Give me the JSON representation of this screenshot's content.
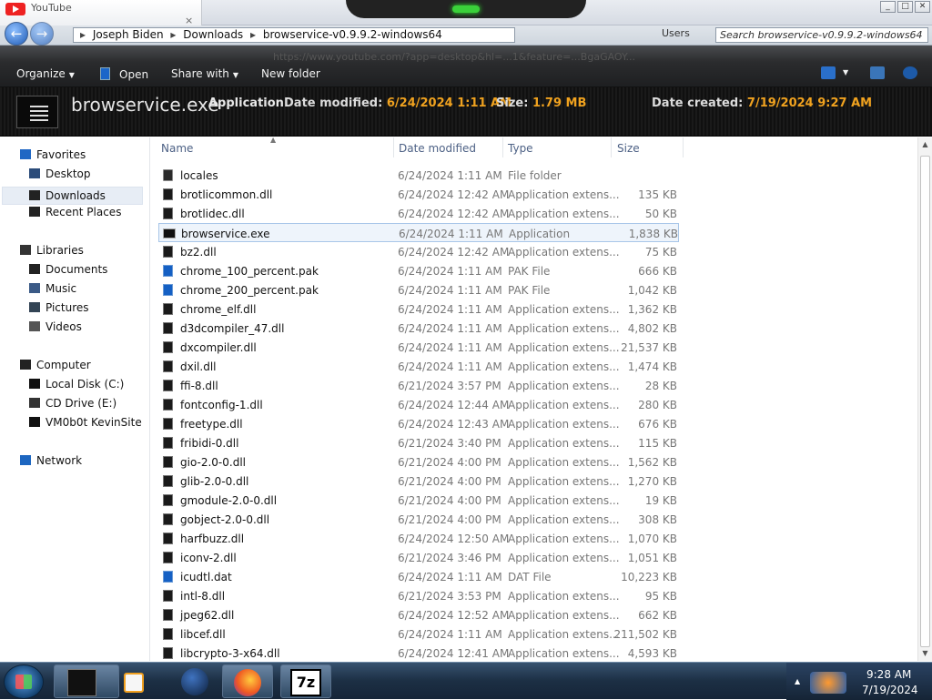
{
  "window": {
    "tab_label": "YouTube",
    "tab_close": "×",
    "controls": [
      "_",
      "□",
      "✕"
    ]
  },
  "nav": {
    "back": "←",
    "forward": "→",
    "breadcrumb": [
      "Joseph Biden",
      "Downloads",
      "browservice-v0.9.9.2-windows64"
    ],
    "breadcrumb_more": "▸",
    "refresh_label": "Users",
    "search_placeholder": "Search browservice-v0.9.9.2-windows64"
  },
  "toolbar": {
    "organize": "Organize",
    "open": "Open",
    "share_with": "Share with",
    "new_folder": "New folder",
    "url_ghost": "https://www.youtube.com/?app=desktop&hl=...1&feature=...BgaGAOY..."
  },
  "details": {
    "name": "browservice.exe",
    "type": "Application",
    "date_modified_label": "Date modified:",
    "date_modified": "6/24/2024 1:11 AM",
    "size_label": "Size:",
    "size": "1.79 MB",
    "date_created_label": "Date created:",
    "date_created": "7/19/2024 9:27 AM",
    "accent_color": "#f0a21f"
  },
  "navpane": {
    "items": [
      {
        "label": "Favorites",
        "icon": "star-icon"
      },
      {
        "label": "Desktop",
        "icon": "desktop-icon"
      },
      {
        "label": "Downloads",
        "icon": "downloads-icon",
        "selected": true
      },
      {
        "label": "Recent Places",
        "icon": "recent-places-icon"
      },
      {
        "label": "Libraries",
        "icon": "libraries-icon"
      },
      {
        "label": "Documents",
        "icon": "documents-icon"
      },
      {
        "label": "Music",
        "icon": "music-icon"
      },
      {
        "label": "Pictures",
        "icon": "pictures-icon"
      },
      {
        "label": "Videos",
        "icon": "videos-icon"
      },
      {
        "label": "Computer",
        "icon": "computer-icon"
      },
      {
        "label": "Local Disk (C:)",
        "icon": "disk-icon"
      },
      {
        "label": "CD Drive (E:)",
        "icon": "cd-drive-icon"
      },
      {
        "label": "VM0b0t KevinSite",
        "icon": "network-drive-icon"
      },
      {
        "label": "Network",
        "icon": "network-icon"
      }
    ]
  },
  "columns": {
    "name": "Name",
    "date_modified": "Date modified",
    "type": "Type",
    "size": "Size"
  },
  "files": [
    {
      "name": "locales",
      "date": "6/24/2024 1:11 AM",
      "type": "File folder",
      "size": "",
      "kind": "folder"
    },
    {
      "name": "brotlicommon.dll",
      "date": "6/24/2024 12:42 AM",
      "type": "Application extens...",
      "size": "135 KB",
      "kind": "dll"
    },
    {
      "name": "brotlidec.dll",
      "date": "6/24/2024 12:42 AM",
      "type": "Application extens...",
      "size": "50 KB",
      "kind": "dll"
    },
    {
      "name": "browservice.exe",
      "date": "6/24/2024 1:11 AM",
      "type": "Application",
      "size": "1,838 KB",
      "kind": "exe",
      "selected": true
    },
    {
      "name": "bz2.dll",
      "date": "6/24/2024 12:42 AM",
      "type": "Application extens...",
      "size": "75 KB",
      "kind": "dll"
    },
    {
      "name": "chrome_100_percent.pak",
      "date": "6/24/2024 1:11 AM",
      "type": "PAK File",
      "size": "666 KB",
      "kind": "pak"
    },
    {
      "name": "chrome_200_percent.pak",
      "date": "6/24/2024 1:11 AM",
      "type": "PAK File",
      "size": "1,042 KB",
      "kind": "pak"
    },
    {
      "name": "chrome_elf.dll",
      "date": "6/24/2024 1:11 AM",
      "type": "Application extens...",
      "size": "1,362 KB",
      "kind": "dll"
    },
    {
      "name": "d3dcompiler_47.dll",
      "date": "6/24/2024 1:11 AM",
      "type": "Application extens...",
      "size": "4,802 KB",
      "kind": "dll"
    },
    {
      "name": "dxcompiler.dll",
      "date": "6/24/2024 1:11 AM",
      "type": "Application extens...",
      "size": "21,537 KB",
      "kind": "dll"
    },
    {
      "name": "dxil.dll",
      "date": "6/24/2024 1:11 AM",
      "type": "Application extens...",
      "size": "1,474 KB",
      "kind": "dll"
    },
    {
      "name": "ffi-8.dll",
      "date": "6/21/2024 3:57 PM",
      "type": "Application extens...",
      "size": "28 KB",
      "kind": "dll"
    },
    {
      "name": "fontconfig-1.dll",
      "date": "6/24/2024 12:44 AM",
      "type": "Application extens...",
      "size": "280 KB",
      "kind": "dll"
    },
    {
      "name": "freetype.dll",
      "date": "6/24/2024 12:43 AM",
      "type": "Application extens...",
      "size": "676 KB",
      "kind": "dll"
    },
    {
      "name": "fribidi-0.dll",
      "date": "6/21/2024 3:40 PM",
      "type": "Application extens...",
      "size": "115 KB",
      "kind": "dll"
    },
    {
      "name": "gio-2.0-0.dll",
      "date": "6/21/2024 4:00 PM",
      "type": "Application extens...",
      "size": "1,562 KB",
      "kind": "dll"
    },
    {
      "name": "glib-2.0-0.dll",
      "date": "6/21/2024 4:00 PM",
      "type": "Application extens...",
      "size": "1,270 KB",
      "kind": "dll"
    },
    {
      "name": "gmodule-2.0-0.dll",
      "date": "6/21/2024 4:00 PM",
      "type": "Application extens...",
      "size": "19 KB",
      "kind": "dll"
    },
    {
      "name": "gobject-2.0-0.dll",
      "date": "6/21/2024 4:00 PM",
      "type": "Application extens...",
      "size": "308 KB",
      "kind": "dll"
    },
    {
      "name": "harfbuzz.dll",
      "date": "6/24/2024 12:50 AM",
      "type": "Application extens...",
      "size": "1,070 KB",
      "kind": "dll"
    },
    {
      "name": "iconv-2.dll",
      "date": "6/21/2024 3:46 PM",
      "type": "Application extens...",
      "size": "1,051 KB",
      "kind": "dll"
    },
    {
      "name": "icudtl.dat",
      "date": "6/24/2024 1:11 AM",
      "type": "DAT File",
      "size": "10,223 KB",
      "kind": "pak"
    },
    {
      "name": "intl-8.dll",
      "date": "6/21/2024 3:53 PM",
      "type": "Application extens...",
      "size": "95 KB",
      "kind": "dll"
    },
    {
      "name": "jpeg62.dll",
      "date": "6/24/2024 12:52 AM",
      "type": "Application extens...",
      "size": "662 KB",
      "kind": "dll"
    },
    {
      "name": "libcef.dll",
      "date": "6/24/2024 1:11 AM",
      "type": "Application extens...",
      "size": "211,502 KB",
      "kind": "dll"
    },
    {
      "name": "libcrypto-3-x64.dll",
      "date": "6/24/2024 12:41 AM",
      "type": "Application extens...",
      "size": "4,593 KB",
      "kind": "dll"
    }
  ],
  "taskbar": {
    "items": [
      "explorer-icon",
      "media-player-icon",
      "globe-icon",
      "firefox-icon",
      "7zip-icon"
    ],
    "sevenzip_label": "7z",
    "time": "9:28 AM",
    "date": "7/19/2024"
  }
}
